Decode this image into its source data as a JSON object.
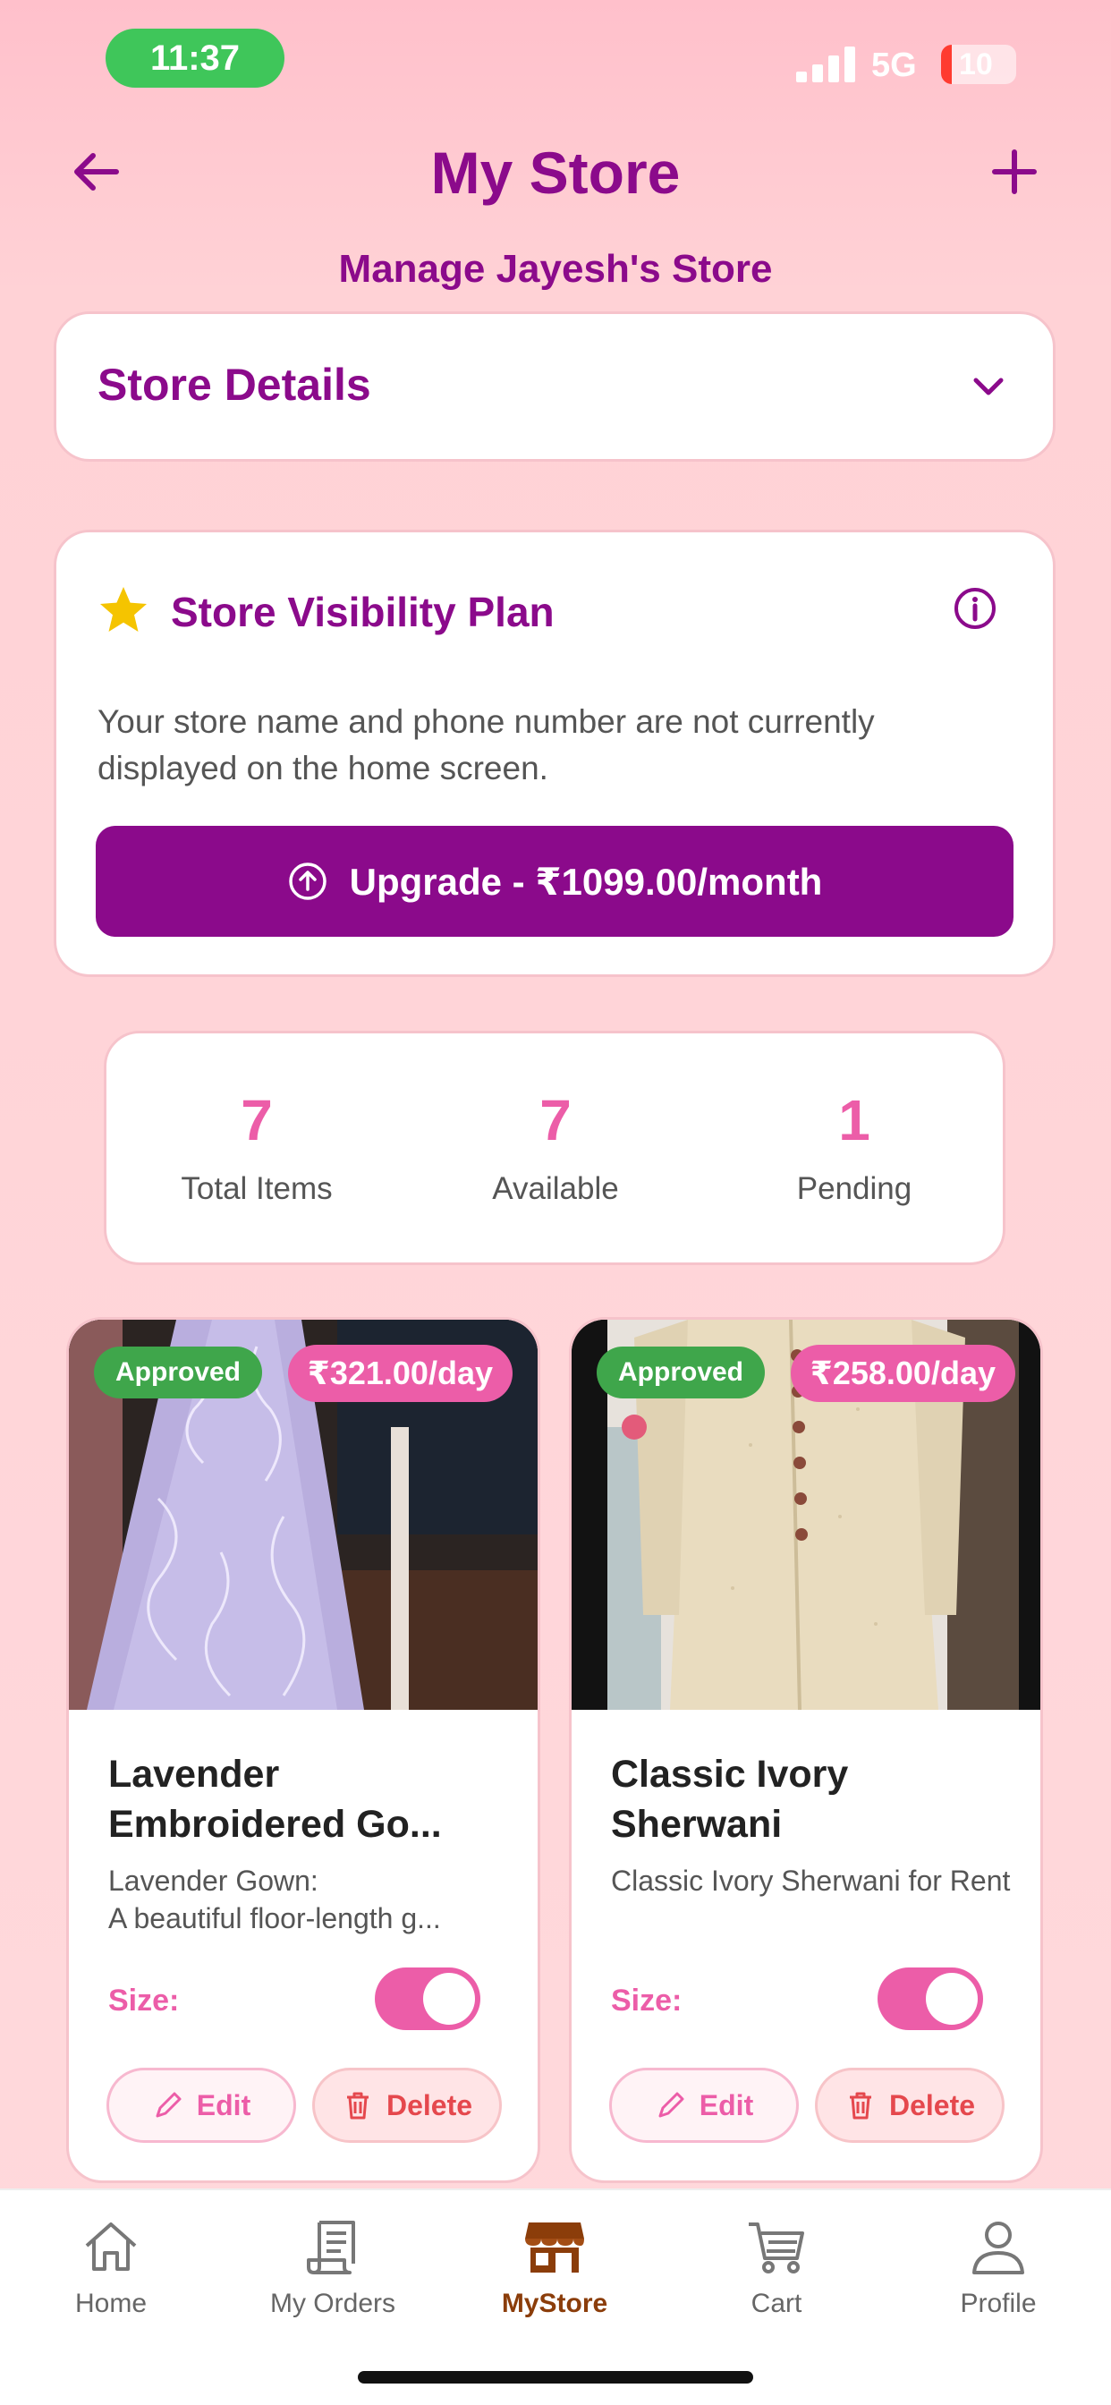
{
  "status_bar": {
    "time": "11:37",
    "network": "5G",
    "battery": "10"
  },
  "header": {
    "title": "My Store",
    "subtitle": "Manage Jayesh's Store"
  },
  "store_details": {
    "label": "Store Details"
  },
  "visibility_plan": {
    "title": "Store Visibility Plan",
    "description": "Your store name and phone number are not currently displayed on the home screen.",
    "upgrade_label": "Upgrade - ₹1099.00/month"
  },
  "stats": [
    {
      "value": "7",
      "label": "Total Items"
    },
    {
      "value": "7",
      "label": "Available"
    },
    {
      "value": "1",
      "label": "Pending"
    }
  ],
  "products": [
    {
      "status": "Approved",
      "price": "₹321.00/day",
      "name": "Lavender Embroidered Go...",
      "description": "Lavender Gown:\nA beautiful floor-length g...",
      "size_label": "Size:",
      "toggle_on": true,
      "edit_label": "Edit",
      "delete_label": "Delete"
    },
    {
      "status": "Approved",
      "price": "₹258.00/day",
      "name": "Classic Ivory Sherwani",
      "description": "Classic Ivory Sherwani for Rent",
      "size_label": "Size:",
      "toggle_on": true,
      "edit_label": "Edit",
      "delete_label": "Delete"
    }
  ],
  "bottom_nav": [
    {
      "label": "Home",
      "icon": "home-icon",
      "active": false
    },
    {
      "label": "My Orders",
      "icon": "orders-icon",
      "active": false
    },
    {
      "label": "MyStore",
      "icon": "store-icon",
      "active": true
    },
    {
      "label": "Cart",
      "icon": "cart-icon",
      "active": false
    },
    {
      "label": "Profile",
      "icon": "profile-icon",
      "active": false
    }
  ],
  "colors": {
    "brand_purple": "#8b0a8b",
    "accent_pink": "#ec5da8",
    "approved_green": "#3fa64b",
    "delete_red": "#e5484d"
  }
}
